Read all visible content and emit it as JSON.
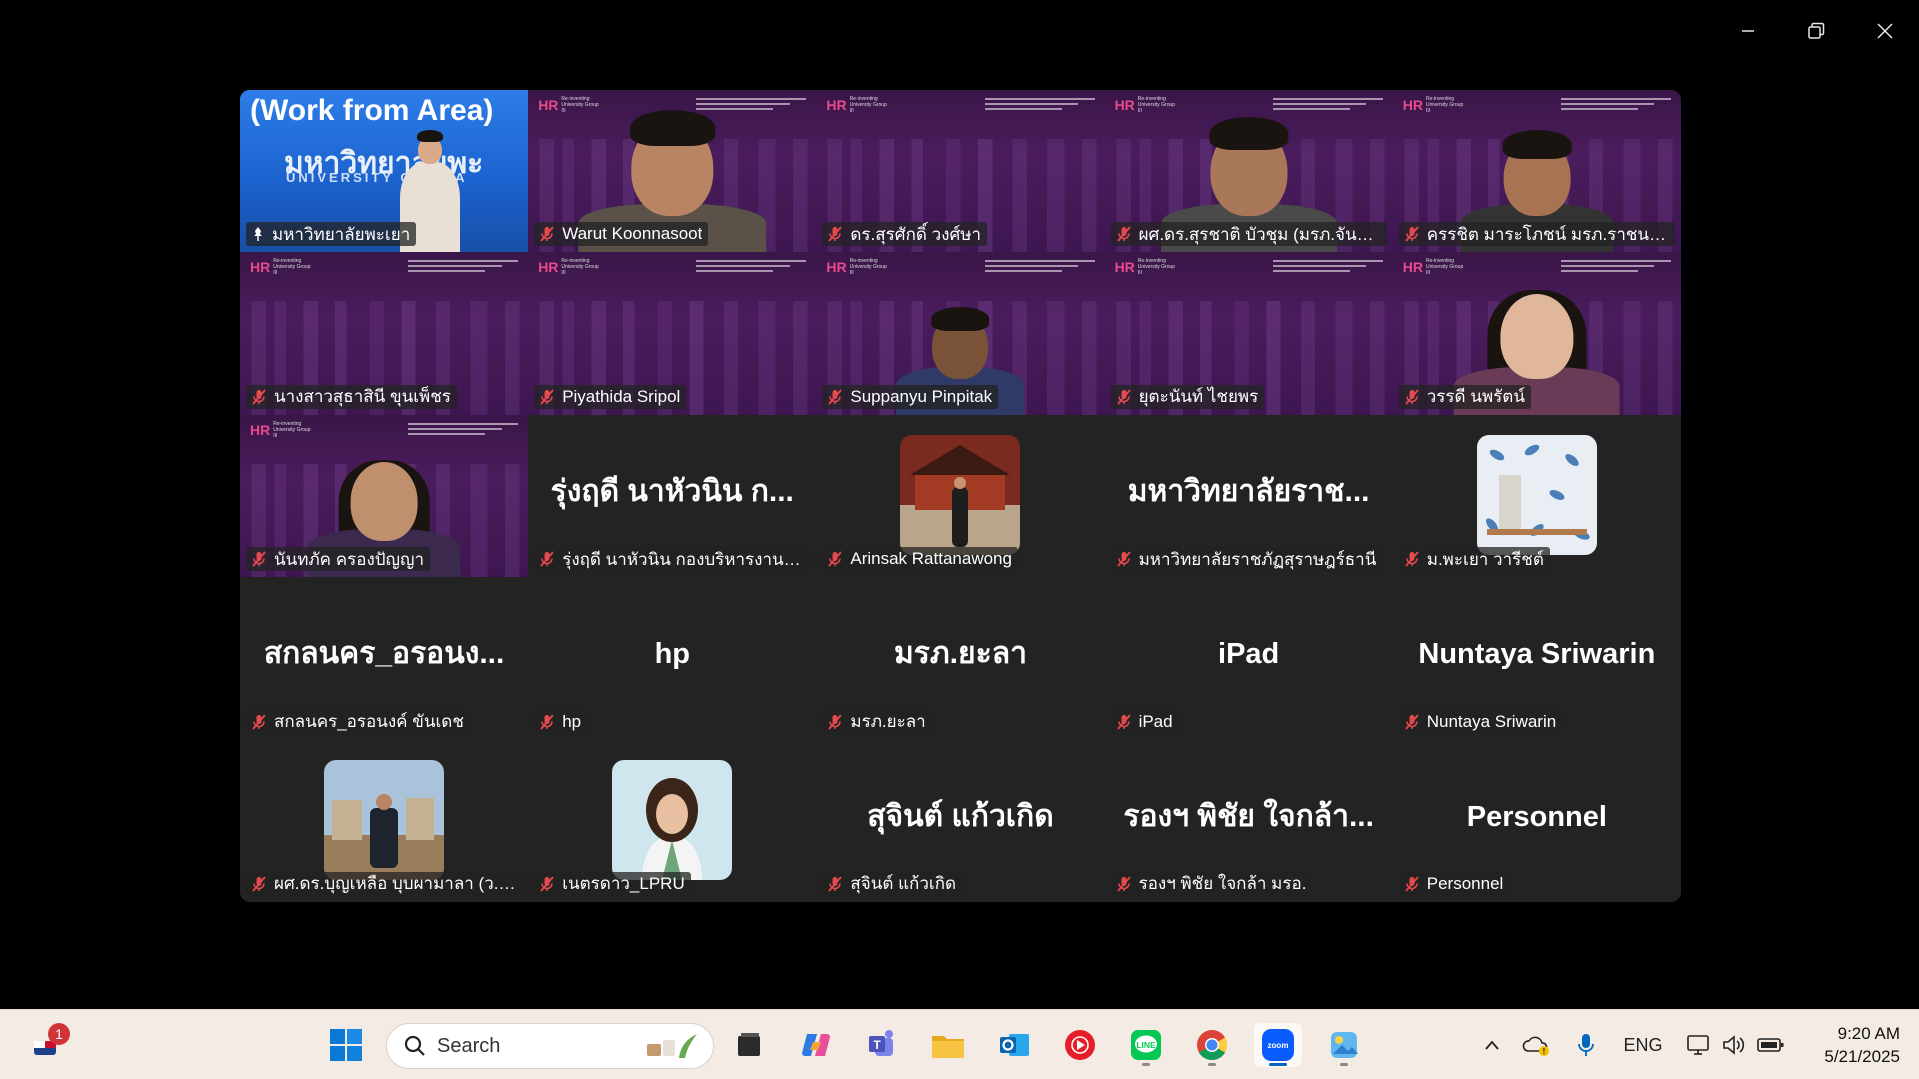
{
  "window_controls": {
    "minimize": "minimize",
    "maximize": "restore",
    "close": "close"
  },
  "tile0": {
    "overlay_title": "(Work from Area)",
    "overlay_sub": "มหาวิทยาลัยพะ",
    "overlay_sub2": "UNIVERSITY OF PHA"
  },
  "hr_logo": {
    "letters": "HR",
    "tagline": "Re-inventing University Group III"
  },
  "participants": [
    {
      "name": "มหาวิทยาลัยพะเยา",
      "big": "",
      "host": true
    },
    {
      "name": "Warut Koonnasoot",
      "big": ""
    },
    {
      "name": "ดร.สุรศักดิ์ วงศ์ษา",
      "big": ""
    },
    {
      "name": "ผศ.ดร.สุรชาติ บัวชุม (มรภ.จันทร...",
      "big": ""
    },
    {
      "name": "ครรชิต มาระโภชน์ มรภ.ราชนครินทร...",
      "big": ""
    },
    {
      "name": "นางสาวสุธาสินี ขุนเพ็ชร",
      "big": ""
    },
    {
      "name": "Piyathida Sripol",
      "big": ""
    },
    {
      "name": "Suppanyu Pinpitak",
      "big": ""
    },
    {
      "name": "ยุตะนันท์ ไชยพร",
      "big": ""
    },
    {
      "name": "วรรดี นพรัตน์",
      "big": ""
    },
    {
      "name": "นันทภัค ครองปัญญา",
      "big": ""
    },
    {
      "name": "รุ่งฤดี นาหัวนิน กองบริหารงานบุค...",
      "big": "รุ่งฤดี นาหัวนิน ก..."
    },
    {
      "name": "Arinsak Rattanawong",
      "big": ""
    },
    {
      "name": "มหาวิทยาลัยราชภัฏสุราษฎร์ธานี",
      "big": "มหาวิทยาลัยราช..."
    },
    {
      "name": "ม.พะเยา วารีชต์",
      "big": ""
    },
    {
      "name": "สกลนคร_อรอนงค์ ขันเดช",
      "big": "สกลนคร_อรอนง..."
    },
    {
      "name": "hp",
      "big": "hp"
    },
    {
      "name": "มรภ.ยะลา",
      "big": "มรภ.ยะลา"
    },
    {
      "name": "iPad",
      "big": "iPad"
    },
    {
      "name": "Nuntaya Sriwarin",
      "big": "Nuntaya Sriwarin"
    },
    {
      "name": "ผศ.ดร.บุญเหลือ บุบผามาลา (ว.พิ...",
      "big": ""
    },
    {
      "name": "เนตรดาว_LPRU",
      "big": ""
    },
    {
      "name": "สุจินต์ แก้วเกิด",
      "big": "สุจินต์ แก้วเกิด"
    },
    {
      "name": "รองฯ พิชัย ใจกล้า มรอ.",
      "big": "รองฯ พิชัย ใจกล้า..."
    },
    {
      "name": "Personnel",
      "big": "Personnel"
    }
  ],
  "taskbar": {
    "notification_badge": "1",
    "search_placeholder": "Search",
    "apps": [
      "start-icon",
      "file-manager-icon",
      "copilot-icon",
      "teams-icon",
      "folder-icon",
      "outlook-icon",
      "youtube-music-icon",
      "line-icon",
      "chrome-icon",
      "zoom-icon",
      "photos-icon"
    ],
    "tray_lang": "ENG",
    "clock_time": "9:20 AM",
    "clock_date": "5/21/2025"
  },
  "colors": {
    "active_speaker": "#2fe3b0",
    "muted_mic": "#e5484d",
    "tile_bg": "#232323",
    "hr_purple": "#4a1c5c"
  }
}
